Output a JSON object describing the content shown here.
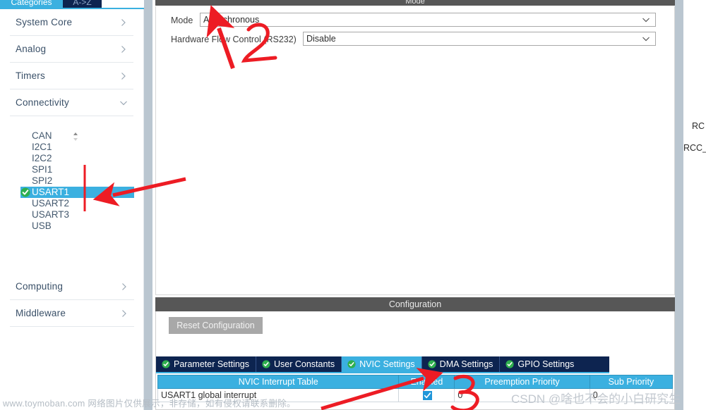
{
  "sidebar": {
    "tabs": [
      {
        "label": "Categories",
        "active": true
      },
      {
        "label": "A->Z",
        "active": false
      }
    ],
    "categories": [
      {
        "label": "System Core",
        "expanded": false,
        "chevron": "chevron-right-icon"
      },
      {
        "label": "Analog",
        "expanded": false,
        "chevron": "chevron-right-icon"
      },
      {
        "label": "Timers",
        "expanded": false,
        "chevron": "chevron-right-icon"
      },
      {
        "label": "Connectivity",
        "expanded": true,
        "chevron": "chevron-down-icon"
      }
    ],
    "categories_below": [
      {
        "label": "Computing",
        "expanded": false,
        "chevron": "chevron-right-icon"
      },
      {
        "label": "Middleware",
        "expanded": false,
        "chevron": "chevron-right-icon"
      }
    ],
    "peripherals": [
      {
        "label": "CAN",
        "selected": false,
        "configured": false
      },
      {
        "label": "I2C1",
        "selected": false,
        "configured": false
      },
      {
        "label": "I2C2",
        "selected": false,
        "configured": false
      },
      {
        "label": "SPI1",
        "selected": false,
        "configured": false
      },
      {
        "label": "SPI2",
        "selected": false,
        "configured": false
      },
      {
        "label": "USART1",
        "selected": true,
        "configured": true
      },
      {
        "label": "USART2",
        "selected": false,
        "configured": false
      },
      {
        "label": "USART3",
        "selected": false,
        "configured": false
      },
      {
        "label": "USB",
        "selected": false,
        "configured": false
      }
    ],
    "scroll_indicator": "scroll-up-down-icon"
  },
  "mode_panel": {
    "title": "Mode",
    "rows": [
      {
        "label": "Mode",
        "value": "Asynchronous"
      },
      {
        "label": "Hardware Flow Control (RS232)",
        "value": "Disable"
      }
    ]
  },
  "config_panel": {
    "title": "Configuration",
    "reset_label": "Reset Configuration",
    "tabs": [
      {
        "label": "Parameter Settings",
        "active": false,
        "icon": "green-check-icon"
      },
      {
        "label": "User Constants",
        "active": false,
        "icon": "green-check-icon"
      },
      {
        "label": "NVIC Settings",
        "active": true,
        "icon": "green-check-icon"
      },
      {
        "label": "DMA Settings",
        "active": false,
        "icon": "green-check-icon"
      },
      {
        "label": "GPIO Settings",
        "active": false,
        "icon": "green-check-icon"
      }
    ],
    "nvic_table": {
      "headers": [
        "NVIC Interrupt Table",
        "Enabled",
        "Preemption Priority",
        "Sub Priority"
      ],
      "rows": [
        {
          "name": "USART1 global interrupt",
          "enabled": true,
          "preemption_priority": "0",
          "sub_priority": "0"
        }
      ]
    }
  },
  "right_panel": {
    "clipped_labels": [
      "RC",
      "RCC_"
    ]
  },
  "watermarks": {
    "left": "www.toymoban.com 网络图片仅供展示，非存储，如有侵权请联系删除。",
    "right": "CSDN @啥也不会的小白研究生"
  },
  "annotations": {
    "color": "#ed1c24",
    "items": [
      {
        "type": "arrow",
        "name": "arrow-to-usart1"
      },
      {
        "type": "line",
        "name": "vertical-marker-usart1"
      },
      {
        "type": "arrow",
        "name": "arrow-to-mode-combo"
      },
      {
        "type": "digit",
        "name": "digit-2-annotation",
        "text": "2"
      },
      {
        "type": "arrow",
        "name": "arrow-to-enabled-checkbox"
      },
      {
        "type": "digit",
        "name": "digit-3-annotation",
        "text": "3"
      }
    ]
  },
  "colors": {
    "accent_blue": "#3bb0e0",
    "tab_navy": "#0d2450",
    "panel_header_gray": "#575757",
    "annotation_red": "#ed1c24",
    "green_check": "#2eaf4e"
  }
}
